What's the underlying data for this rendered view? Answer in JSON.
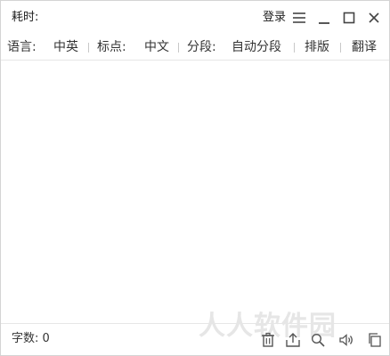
{
  "titlebar": {
    "elapsed_label": "耗时:",
    "login_label": "登录"
  },
  "toolbar": {
    "language_label": "语言:",
    "language_value": "中英",
    "punctuation_label": "标点:",
    "punctuation_value": "中文",
    "paragraph_label": "分段:",
    "paragraph_value": "自动分段",
    "layout_button": "排版",
    "translate_button": "翻译"
  },
  "statusbar": {
    "word_count_label": "字数:",
    "word_count_value": "0"
  },
  "watermark": "人人软件园",
  "icons": {
    "menu": "menu-icon",
    "minimize": "minimize-icon",
    "maximize": "maximize-icon",
    "close": "close-icon",
    "delete": "trash-icon",
    "export": "export-icon",
    "search": "search-icon",
    "speak": "speaker-icon",
    "copy": "copy-icon"
  },
  "colors": {
    "text": "#333333",
    "icon": "#555555",
    "border": "#d4d4d4"
  }
}
